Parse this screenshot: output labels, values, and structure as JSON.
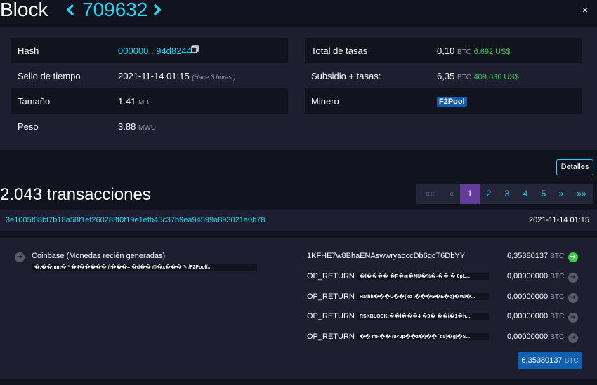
{
  "header": {
    "title": "Block",
    "height": "709632",
    "prev_icon": "chevron-left-icon",
    "next_icon": "chevron-right-icon",
    "close_label": "×"
  },
  "details": {
    "hash": {
      "label": "Hash",
      "value": "000000...94d8244"
    },
    "timestamp": {
      "label": "Sello de tiempo",
      "value": "2021-11-14 01:15",
      "relative": "(Hace 3 horas )"
    },
    "size": {
      "label": "Tamaño",
      "value": "1.41",
      "unit": "MB"
    },
    "weight": {
      "label": "Peso",
      "value": "3.88",
      "unit": "MWU"
    },
    "fees": {
      "label": "Total de tasas",
      "value": "0,10",
      "unit": "BTC",
      "usd": "6.692 US$"
    },
    "subsidy": {
      "label": "Subsidio + tasas:",
      "value": "6,35",
      "unit": "BTC",
      "usd": "409.636 US$"
    },
    "miner": {
      "label": "Minero",
      "value": "F2Pool"
    }
  },
  "details_button": "Detalles",
  "tx_count": "2.043 transacciones",
  "pagination": [
    "««",
    "«",
    "1",
    "2",
    "3",
    "4",
    "5",
    "»",
    "»»"
  ],
  "transaction": {
    "txid": "3e1005f68bf7b18a58f1ef260283f0f19e1efb45c37b9ea94599a893021a0b78",
    "date": "2021-11-14 01:15",
    "input": {
      "label": "Coinbase (Monedas recién generadas)",
      "script": "�,��mm� * �4����� /i���= �d�� @�x��� ✎ /F2Pool/ᵩ"
    },
    "outputs": [
      {
        "address": "1KFHE7w8BhaENAswwryaoccDb6qcT6DbYY",
        "amount": "6,35380137",
        "unit": "BTC"
      },
      {
        "address": "OP_RETURN",
        "script": "�l����  �P�æ�NU�%�-�� �  0pL...",
        "amount": "0,00000000",
        "unit": "BTC"
      },
      {
        "address": "OP_RETURN",
        "script": "Hathh���U��{ko  \\���G�E�q}�Wl�...",
        "amount": "0,00000000",
        "unit": "BTC"
      },
      {
        "address": "OP_RETURN",
        "script": "RSKBLOCK:��l���4  �9�  ��i�1�h...",
        "amount": "0,00000000",
        "unit": "BTC"
      },
      {
        "address": "OP_RETURN",
        "script": "��  mP��  (u<Jp��z�}��  `q5]�g|�S...",
        "amount": "0,00000000",
        "unit": "BTC"
      }
    ],
    "total": "6,35380137",
    "total_unit": "BTC"
  }
}
